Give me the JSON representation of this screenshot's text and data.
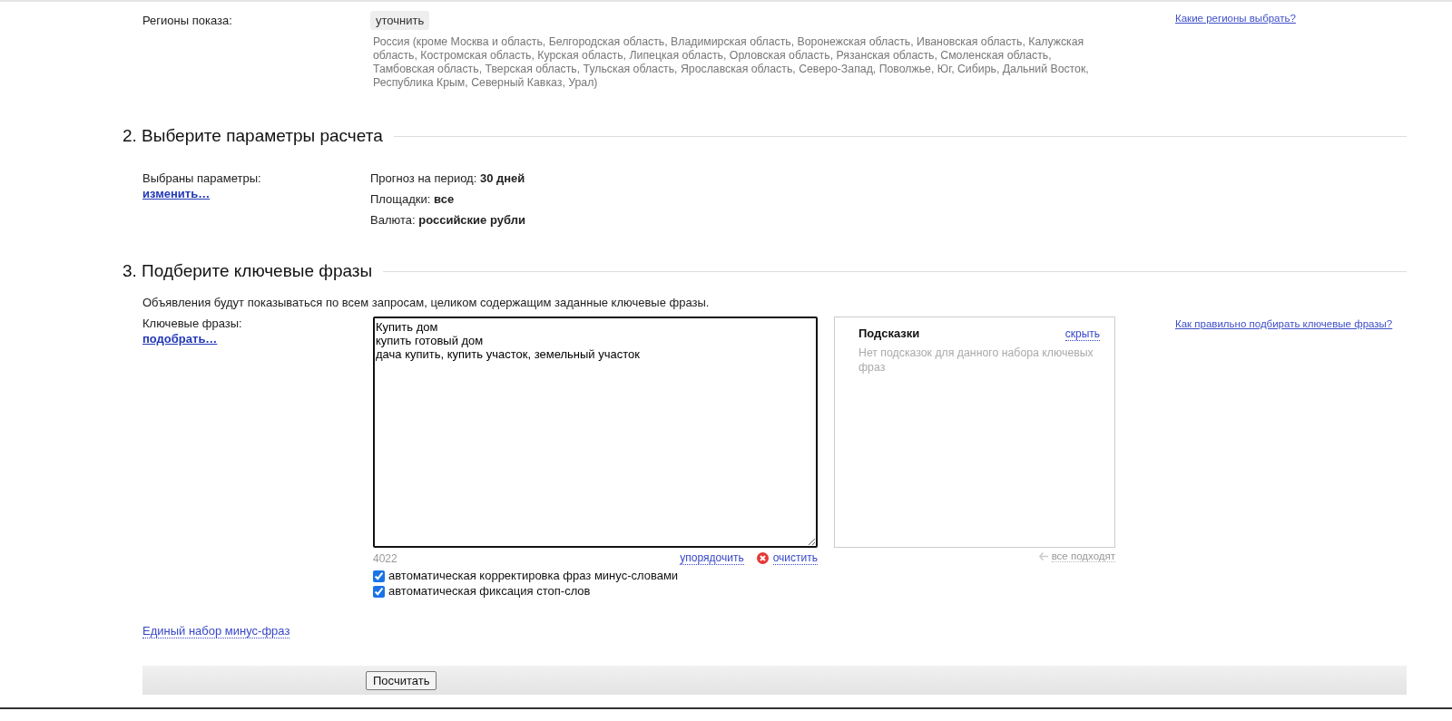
{
  "regions": {
    "label": "Регионы показа:",
    "button": "уточнить",
    "text": "Россия (кроме Москва и область, Белгородская область, Владимирская область, Воронежская область, Ивановская область, Калужская область, Костромская область, Курская область, Липецкая область, Орловская область, Рязанская область, Смоленская область, Тамбовская область, Тверская область, Тульская область, Ярославская область, Северо-Запад, Поволжье, Юг, Сибирь, Дальний Восток, Республика Крым, Северный Кавказ, Урал)",
    "help_link": "Какие регионы выбрать?"
  },
  "params_section": {
    "heading": "2. Выберите параметры расчета",
    "label": "Выбраны параметры:",
    "change_link": "изменить…",
    "params": [
      "Прогноз на период: **30 дней**",
      "Площадки: **все**",
      "Валюта: **российские рубли**"
    ]
  },
  "keywords_section": {
    "heading": "3. Подберите ключевые фразы",
    "description": "Объявления будут показываться по всем запросам, целиком содержащим заданные ключевые фразы.",
    "label": "Ключевые фразы:",
    "pick_link": "подобрать…",
    "textarea": {
      "value": "Купить дом\nкупить готовый дом\nдача купить, купить участок, земельный участок\n"
    },
    "counter": "4022",
    "sort_link": "упорядочить",
    "clear_link": "очистить",
    "checkboxes": [
      {
        "label": "автоматическая корректировка фраз минус-словами",
        "checked": true
      },
      {
        "label": "автоматическая фиксация стоп-слов",
        "checked": true
      }
    ],
    "hints": {
      "title": "Подсказки",
      "hide_link": "скрыть",
      "empty_text": "Нет подсказок для данного набора ключевых фраз",
      "all_fit_link": "все подходят",
      "all_fit_disabled": true
    },
    "help_link": "Как правильно подбирать ключевые фразы?"
  },
  "minus_phrases_link": "Единый набор минус-фраз",
  "submit_button": "Посчитать"
}
